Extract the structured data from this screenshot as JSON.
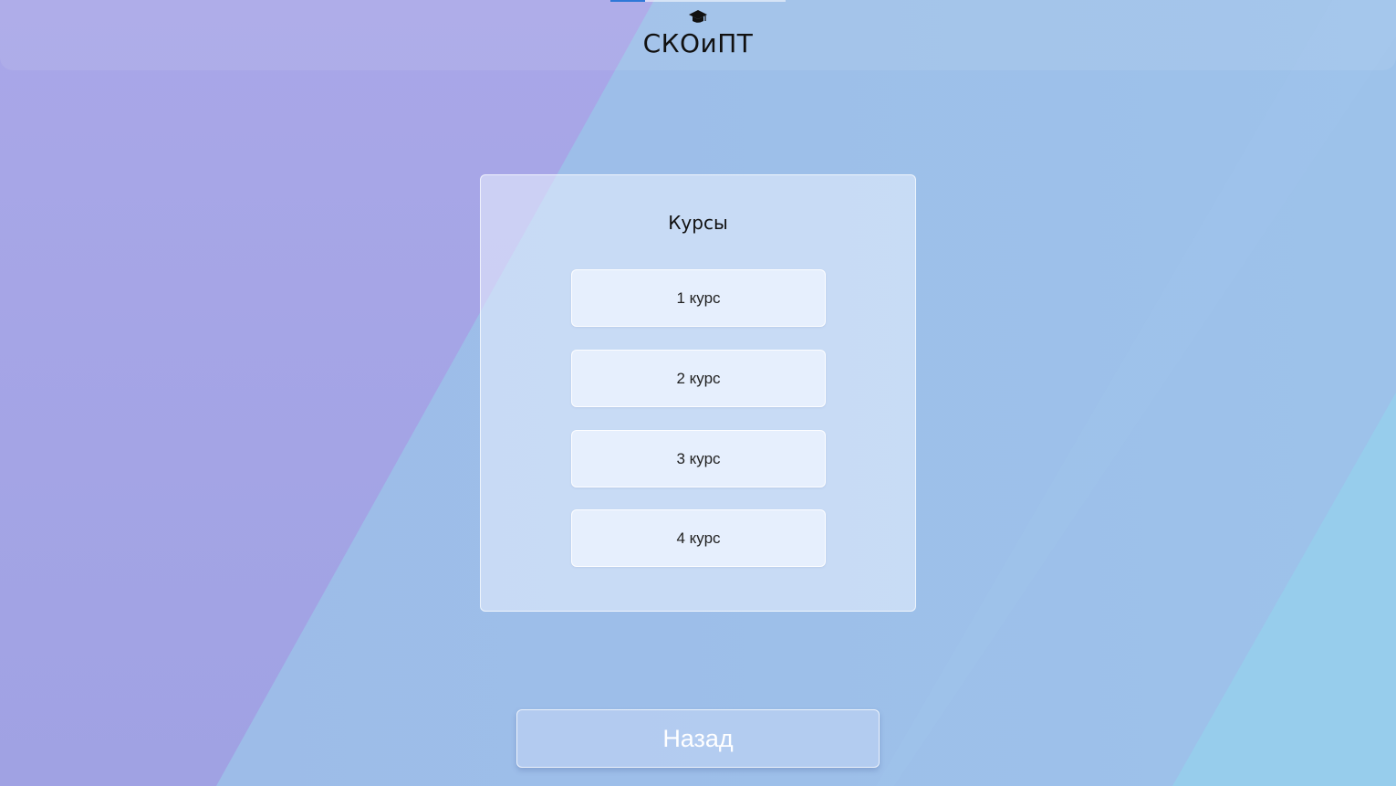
{
  "header": {
    "logo_text": "СКОиПТ",
    "logo_icon": "graduation-cap-icon"
  },
  "courses": {
    "title": "Курсы",
    "items": [
      {
        "label": "1 курс"
      },
      {
        "label": "2 курс"
      },
      {
        "label": "3 курс"
      },
      {
        "label": "4 курс"
      }
    ]
  },
  "back_button": {
    "label": "Назад"
  },
  "colors": {
    "background_left": "#a3a1e5",
    "background_middle": "#9dbbe8",
    "background_right": "#97cdec",
    "accent": "#2f78d8"
  }
}
